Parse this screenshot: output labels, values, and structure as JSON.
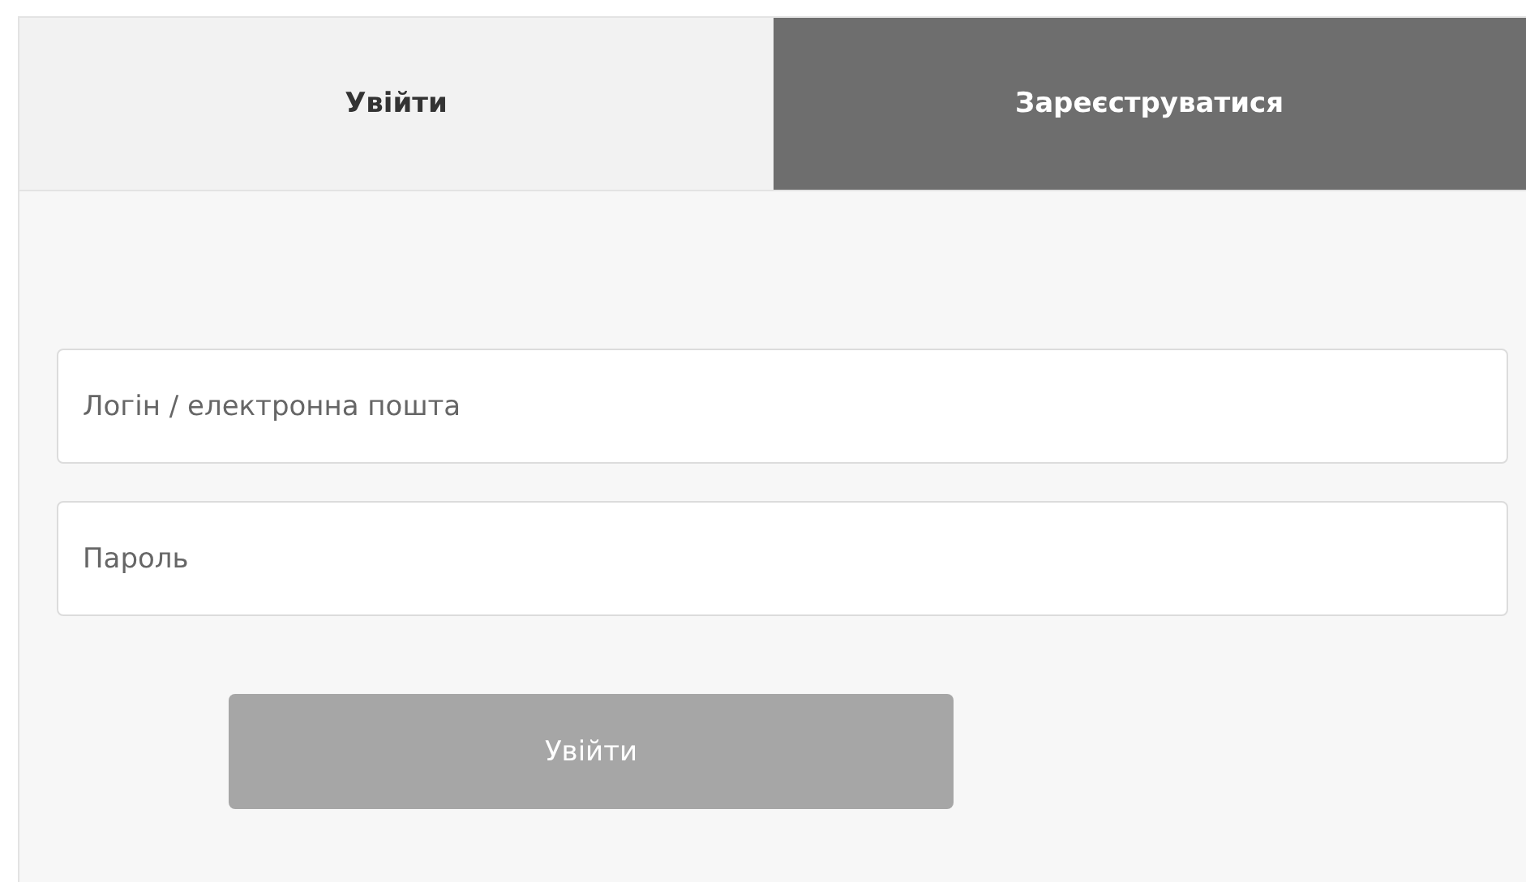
{
  "tabs": [
    {
      "label": "Увійти",
      "selected": true
    },
    {
      "label": "Зареєструватися",
      "selected": false
    }
  ],
  "fields": [
    {
      "placeholder": "Логін / електронна пошта"
    },
    {
      "placeholder": "Пароль"
    }
  ],
  "submit_button": {
    "label": "Увійти"
  }
}
